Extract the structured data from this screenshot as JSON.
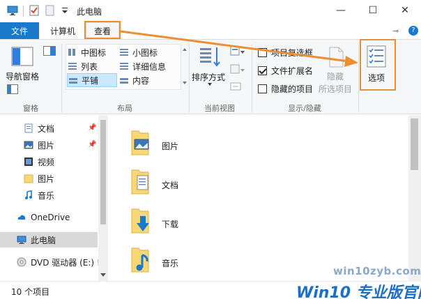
{
  "window": {
    "title": "此电脑",
    "minimize_glyph": "—",
    "maximize_glyph": "☐",
    "close_glyph": "✕"
  },
  "tabs": {
    "file": "文件",
    "computer": "计算机",
    "view": "查看",
    "pin_glyph": "⊸",
    "help_glyph": "?"
  },
  "ribbon": {
    "panes": {
      "nav_pane": "导航窗格",
      "group_label": "窗格"
    },
    "layout": {
      "group_label": "布局",
      "items": [
        "中图标",
        "小图标",
        "列表",
        "详细信息",
        "平铺",
        "内容"
      ],
      "selected": "平铺"
    },
    "current_view": {
      "sort_by": "排序方式",
      "group_label": "当前视图"
    },
    "show_hide": {
      "group_label": "显示/隐藏",
      "item_checkboxes": "项目复选框",
      "file_extensions": "文件扩展名",
      "hidden_items": "隐藏的项目",
      "hide_selected_1": "隐藏",
      "hide_selected_2": "所选项目",
      "item_checkboxes_checked": false,
      "file_extensions_checked": true,
      "hidden_items_checked": false
    },
    "options": {
      "label": "选项"
    }
  },
  "nav": {
    "items": [
      {
        "label": "文档",
        "pinned": true
      },
      {
        "label": "图片",
        "pinned": true
      },
      {
        "label": "视频",
        "pinned": false
      },
      {
        "label": "图片",
        "pinned": false
      },
      {
        "label": "音乐",
        "pinned": false
      },
      {
        "label": "OneDrive",
        "pinned": false
      },
      {
        "label": "此电脑",
        "pinned": false
      },
      {
        "label": "DVD 驱动器 (E:) !",
        "pinned": false
      }
    ],
    "pin_glyph": "📌"
  },
  "content": {
    "folders": [
      "图片",
      "文档",
      "下载",
      "音乐"
    ]
  },
  "status": {
    "item_count": "10 个项目"
  },
  "watermark": {
    "site": "win10zyb.com",
    "brand_win": "Win10",
    "brand_rest": " 专业版官网"
  },
  "colors": {
    "accent": "#1979ca",
    "highlight": "#ec8f33",
    "folder": "#f8d775"
  }
}
